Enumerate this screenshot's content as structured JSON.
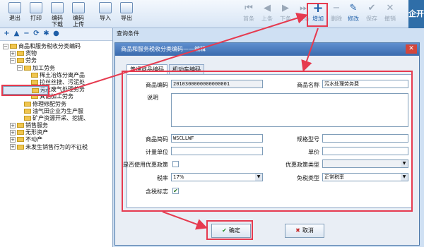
{
  "toolbar": {
    "left": [
      {
        "label": "退出",
        "icon": "exit-icon"
      },
      {
        "label": "打印",
        "icon": "print-icon"
      },
      {
        "label": "编码\n下载",
        "icon": "download-code-icon"
      },
      {
        "label": "编码\n上传",
        "icon": "upload-code-icon"
      },
      {
        "label": "导入",
        "icon": "import-icon"
      },
      {
        "label": "导出",
        "icon": "export-icon"
      }
    ],
    "nav": [
      {
        "label": "首条",
        "icon": "first-record-icon",
        "glyph": "⏮"
      },
      {
        "label": "上条",
        "icon": "previous-record-icon",
        "glyph": "◀"
      },
      {
        "label": "下条",
        "icon": "next-record-icon",
        "glyph": "▶"
      },
      {
        "label": "末条",
        "icon": "last-record-icon",
        "glyph": "⏭"
      },
      {
        "label": "增加",
        "icon": "add-icon",
        "glyph": "+"
      },
      {
        "label": "删除",
        "icon": "delete-icon",
        "glyph": "−"
      },
      {
        "label": "修改",
        "icon": "edit-icon",
        "glyph": "✎"
      },
      {
        "label": "保存",
        "icon": "save-icon",
        "glyph": "✔"
      },
      {
        "label": "撤销",
        "icon": "undo-icon",
        "glyph": "✕"
      }
    ],
    "brand": "企开"
  },
  "tree_toolbar": [
    "+",
    "▲",
    "−",
    "⟳",
    "✱",
    "●"
  ],
  "tree": [
    {
      "label": "商品和服务税收分类编码",
      "depth": 0,
      "expander": "−"
    },
    {
      "label": "货物",
      "depth": 1,
      "expander": "+"
    },
    {
      "label": "劳务",
      "depth": 1,
      "expander": "−"
    },
    {
      "label": "加工劳务",
      "depth": 2,
      "expander": "−"
    },
    {
      "label": "稀土冶炼分离产品",
      "depth": 3,
      "expander": ""
    },
    {
      "label": "拉丝丝搜、污泥处",
      "depth": 3,
      "expander": ""
    },
    {
      "label": "污水处理劳务",
      "depth": 3,
      "expander": "",
      "selected": true
    },
    {
      "label": "工业废气处理劳务",
      "depth": 3,
      "expander": ""
    },
    {
      "label": "其他加工劳务",
      "depth": 3,
      "expander": ""
    },
    {
      "label": "修理修配劳务",
      "depth": 2,
      "expander": ""
    },
    {
      "label": "油气田企业为生产服",
      "depth": 2,
      "expander": ""
    },
    {
      "label": "矿产资源开采、挖掘、",
      "depth": 2,
      "expander": ""
    },
    {
      "label": "销售服务",
      "depth": 1,
      "expander": "+"
    },
    {
      "label": "无形资产",
      "depth": 1,
      "expander": "+"
    },
    {
      "label": "不动产",
      "depth": 1,
      "expander": "+"
    },
    {
      "label": "未发生销售行为的不征税",
      "depth": 1,
      "expander": "+"
    }
  ],
  "query_label": "查询条件",
  "dialog": {
    "title": "商品和服务税收分类编码——编辑",
    "tabs": [
      "普通商品编码",
      "机动车编码"
    ],
    "fields": {
      "code_label": "商品编码",
      "code_value": "2010300000000000001",
      "name_label": "商品名称",
      "name_value": "污水处理劳务费",
      "desc_label": "说明",
      "abbr_label": "商品简码",
      "abbr_value": "WSCLLWF",
      "spec_label": "规格型号",
      "unit_label": "计量单位",
      "price_label": "单价",
      "pref_label": "是否使用优惠政策",
      "pref_type_label": "优惠政策类型",
      "rate_label": "税率",
      "rate_value": "17%",
      "exempt_label": "免税类型",
      "exempt_value": "正常税率",
      "tax_incl_label": "含税标志",
      "tax_incl_checked": "✔"
    },
    "ok_label": "确定",
    "cancel_label": "取消"
  },
  "colors": {
    "highlight": "#e63a4f",
    "accent": "#2f6ea8"
  }
}
